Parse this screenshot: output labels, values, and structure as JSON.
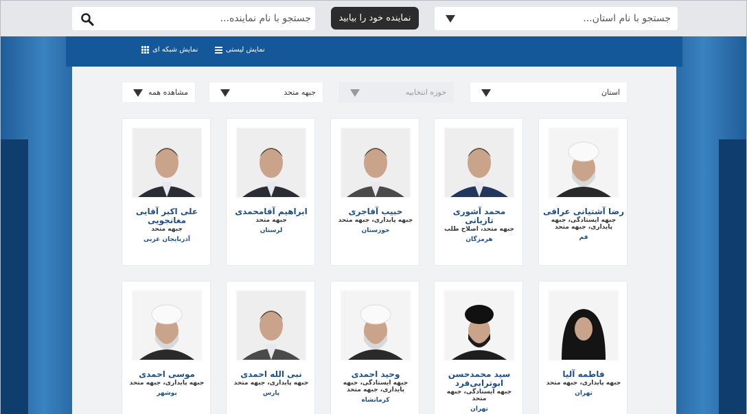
{
  "search": {
    "name_placeholder": "جستجو با نام نماینده...",
    "province_placeholder": "جستجو با نام استان...",
    "find_button": "نماینده خود را بیابید"
  },
  "view": {
    "list_label": "نمایش لیستی",
    "grid_label": "نمایش شبکه ای"
  },
  "filters": {
    "province": "استان",
    "district": "حوزه انتخابیه",
    "faction": "جبهه متحد",
    "show": "مشاهده همه"
  },
  "representatives": [
    {
      "name": "رضا آشتیانی عراقی",
      "party": "جبهه ایستادگی، جبهه پایداری، جبهه متحد",
      "province": "قم",
      "type": "cleric-white"
    },
    {
      "name": "محمد آشوری تازیانی",
      "party": "جبهه متحد، اصلاح طلب",
      "province": "هرمزگان",
      "type": "suit-blue"
    },
    {
      "name": "حبیب آقاجری",
      "party": "جبهه پایداری، جبهه متحد",
      "province": "خوزستان",
      "type": "suit-grey"
    },
    {
      "name": "ابراهیم آقامحمدی",
      "party": "جبهه متحد",
      "province": "لرستان",
      "type": "suit-dark"
    },
    {
      "name": "علی اکبر آقایی مغانجویی",
      "party": "جبهه متحد",
      "province": "آذربایجان غربی",
      "type": "suit-dark"
    },
    {
      "name": "فاطمه آلیا",
      "party": "جبهه پایداری، جبهه متحد",
      "province": "تهران",
      "type": "chador"
    },
    {
      "name": "سید محمدحسن ابوترابی‌فرد",
      "party": "جبهه ایستادگی، جبهه متحد",
      "province": "تهران",
      "type": "cleric-black"
    },
    {
      "name": "وحید احمدی",
      "party": "جبهه ایستادگی، جبهه پایداری، جبهه متحد",
      "province": "کرمانشاه",
      "type": "cleric-white"
    },
    {
      "name": "نبی الله احمدی",
      "party": "جبهه پایداری، جبهه متحد",
      "province": "پارس",
      "type": "suit-grey"
    },
    {
      "name": "موسی احمدی",
      "party": "جبهه پایداری، جبهه متحد",
      "province": "بوشهر",
      "type": "cleric-white"
    }
  ]
}
